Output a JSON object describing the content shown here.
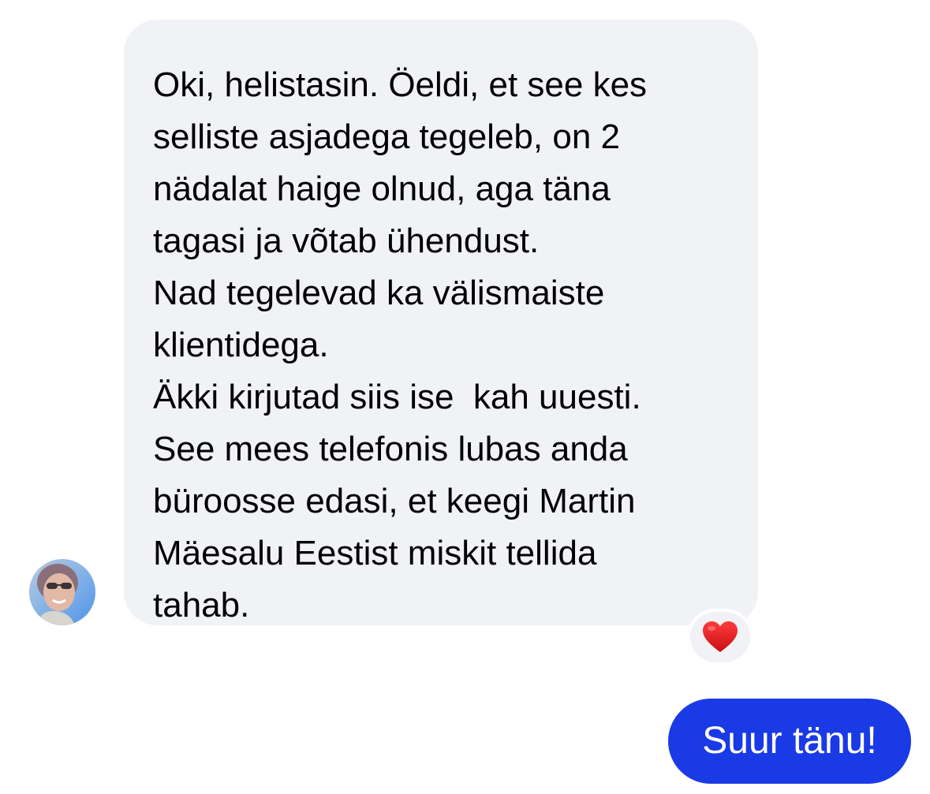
{
  "conversation": {
    "incoming": {
      "sender": "contact",
      "avatar_icon": "contact-avatar-photo",
      "lines": [
        "Oki, helistasin. Öeldi, et see kes",
        "selliste asjadega tegeleb, on 2",
        "nädalat haige olnud, aga täna",
        "tagasi ja võtab ühendust.",
        "Nad tegelevad ka välismaiste",
        "klientidega.",
        "Äkki kirjutad siis ise  kah uuesti.",
        "See mees telefonis lubas anda",
        "büroosse edasi, et keegi Martin",
        "Mäesalu Eestist miskit tellida",
        "tahab."
      ],
      "reaction_icon": "red-heart-icon",
      "bubble_color": "#f1f2f6"
    },
    "outgoing": {
      "text": "Suur tänu!",
      "bubble_color": "#1a3ae6",
      "text_color": "#ffffff"
    }
  }
}
